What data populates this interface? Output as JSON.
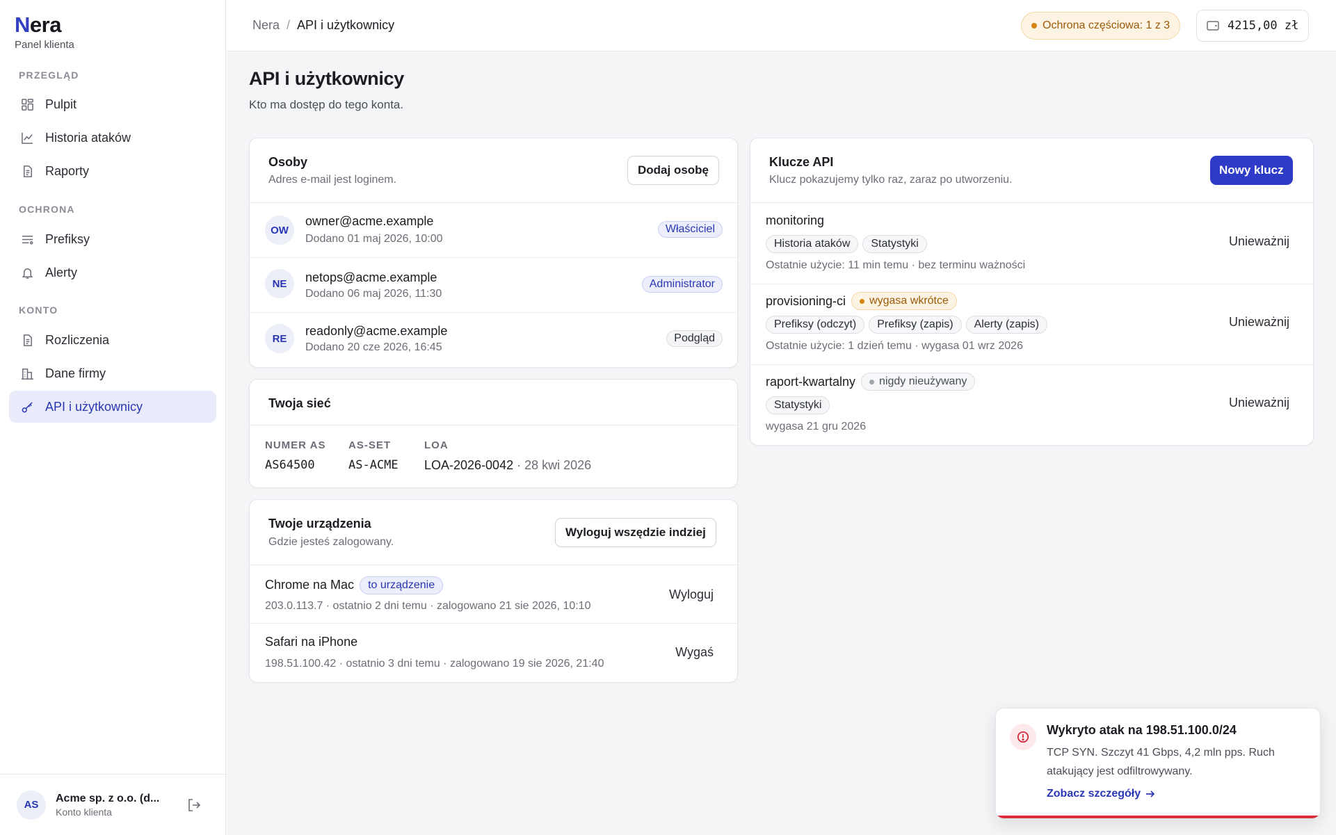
{
  "brand": {
    "name_first": "N",
    "name_rest": "era",
    "subtitle": "Panel klienta"
  },
  "sidebar": {
    "sections": [
      {
        "label": "PRZEGLĄD"
      },
      {
        "label": "OCHRONA"
      },
      {
        "label": "KONTO"
      }
    ],
    "items": [
      {
        "label": "Pulpit",
        "icon": "dashboard-icon"
      },
      {
        "label": "Historia ataków",
        "icon": "chart-line-icon"
      },
      {
        "label": "Raporty",
        "icon": "document-icon"
      },
      {
        "label": "Prefiksy",
        "icon": "list-icon"
      },
      {
        "label": "Alerty",
        "icon": "bell-icon"
      },
      {
        "label": "Rozliczenia",
        "icon": "document-icon"
      },
      {
        "label": "Dane firmy",
        "icon": "building-icon"
      },
      {
        "label": "API i użytkownicy",
        "icon": "key-icon",
        "active": true
      }
    ],
    "account": {
      "initials": "AS",
      "name": "Acme sp. z o.o. (d...",
      "role": "Konto klienta"
    }
  },
  "topbar": {
    "breadcrumb": {
      "root": "Nera",
      "separator": "/",
      "current": "API i użytkownicy"
    },
    "protection_badge": "Ochrona częściowa: 1 z 3",
    "balance": "4215,00 zł"
  },
  "page": {
    "title": "API i użytkownicy",
    "subtitle": "Kto ma dostęp do tego konta."
  },
  "people": {
    "title": "Osoby",
    "desc": "Adres e-mail jest loginem.",
    "add_button": "Dodaj osobę",
    "rows": [
      {
        "initials": "OW",
        "email": "owner@acme.example",
        "added": "Dodano 01 maj 2026, 10:00",
        "role": "Właściciel"
      },
      {
        "initials": "NE",
        "email": "netops@acme.example",
        "added": "Dodano 06 maj 2026, 11:30",
        "role": "Administrator"
      },
      {
        "initials": "RE",
        "email": "readonly@acme.example",
        "added": "Dodano 20 cze 2026, 16:45",
        "role": "Podgląd"
      }
    ]
  },
  "network": {
    "title": "Twoja sieć",
    "asn_label": "NUMER AS",
    "asn": "AS64500",
    "asset_label": "AS-SET",
    "asset": "AS-ACME",
    "loa_label": "LOA",
    "loa_id": "LOA-2026-0042",
    "loa_date": " · 28 kwi 2026"
  },
  "devices": {
    "title": "Twoje urządzenia",
    "desc": "Gdzie jesteś zalogowany.",
    "logout_all": "Wyloguj wszędzie indziej",
    "rows": [
      {
        "name": "Chrome na Mac",
        "tag": "to urządzenie",
        "meta": "203.0.113.7 · ostatnio 2 dni temu · zalogowano 21 sie 2026, 10:10",
        "action": "Wyloguj"
      },
      {
        "name": "Safari na iPhone",
        "meta": "198.51.100.42 · ostatnio 3 dni temu · zalogowano 19 sie 2026, 21:40",
        "action": "Wygaś"
      }
    ]
  },
  "api_keys": {
    "title": "Klucze API",
    "desc": "Klucz pokazujemy tylko raz, zaraz po utworzeniu.",
    "new_button": "Nowy klucz",
    "rows": [
      {
        "name": "monitoring",
        "scopes": [
          "Historia ataków",
          "Statystyki"
        ],
        "meta": "Ostatnie użycie: 11 min temu · bez terminu ważności",
        "action": "Unieważnij"
      },
      {
        "name": "provisioning-ci",
        "status": "wygasa wkrótce",
        "scopes": [
          "Prefiksy (odczyt)",
          "Prefiksy (zapis)",
          "Alerty (zapis)"
        ],
        "meta": "Ostatnie użycie: 1 dzień temu · wygasa 01 wrz 2026",
        "action": "Unieważnij"
      },
      {
        "name": "raport-kwartalny",
        "status": "nigdy nieużywany",
        "scopes": [
          "Statystyki"
        ],
        "meta": "wygasa 21 gru 2026",
        "action": "Unieważnij"
      }
    ]
  },
  "toast": {
    "title": "Wykryto atak na 198.51.100.0/24",
    "body": "TCP SYN. Szczyt 41 Gbps, 4,2 mln pps. Ruch atakujący jest odfiltrowywany.",
    "link": "Zobacz szczegóły",
    "icon": "alert-circle-icon"
  }
}
